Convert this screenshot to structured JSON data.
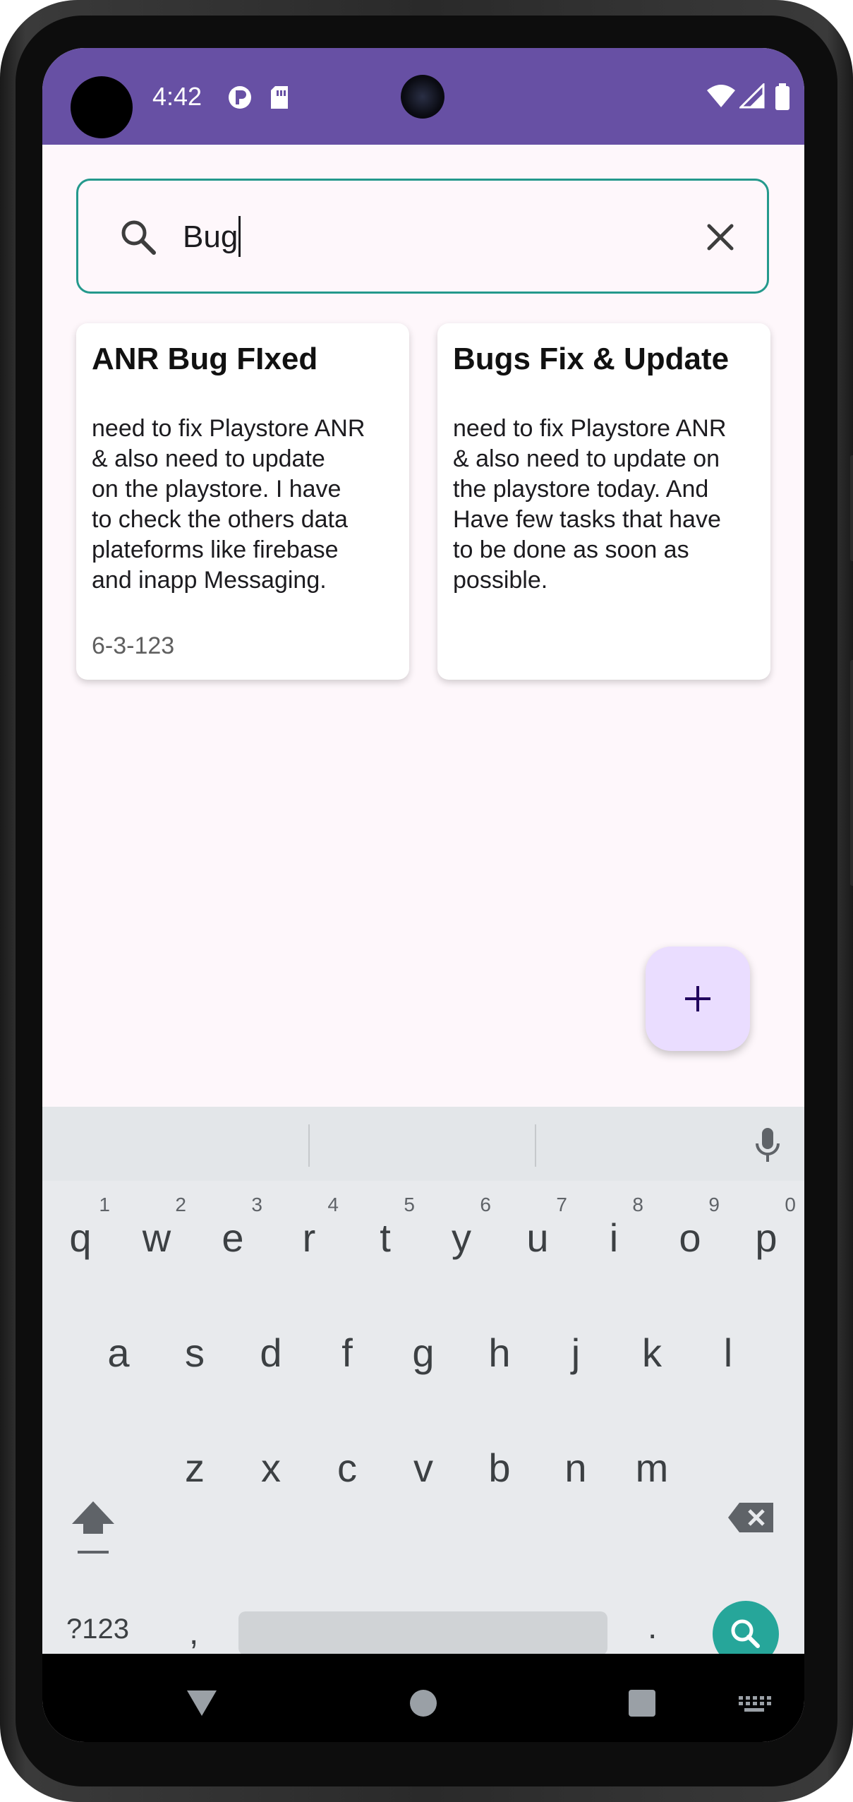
{
  "status_bar": {
    "time": "4:42",
    "background": "#6750a4",
    "icons": [
      "notification-p-icon",
      "sim-card-icon",
      "wifi-icon",
      "signal-icon",
      "battery-icon"
    ]
  },
  "search": {
    "value": "Bug",
    "border_color": "#24998c",
    "icon": "search-icon",
    "clear_icon": "close-icon"
  },
  "notes": [
    {
      "title": "ANR Bug FIxed",
      "lines": [
        "need to fix Playstore ANR",
        "& also need to update",
        "on the playstore. I have",
        "to check the others data",
        "plateforms like firebase",
        "and inapp Messaging."
      ],
      "date": "6-3-123"
    },
    {
      "title": "Bugs Fix & Update",
      "lines": [
        "need to fix Playstore ANR",
        "& also need to update on",
        "the playstore today. And",
        "Have few tasks that have",
        "to be done as soon as",
        "possible."
      ],
      "date": ""
    }
  ],
  "fab": {
    "label": "+",
    "background": "#eaddff"
  },
  "keyboard": {
    "row1": [
      {
        "key": "q",
        "hint": "1"
      },
      {
        "key": "w",
        "hint": "2"
      },
      {
        "key": "e",
        "hint": "3"
      },
      {
        "key": "r",
        "hint": "4"
      },
      {
        "key": "t",
        "hint": "5"
      },
      {
        "key": "y",
        "hint": "6"
      },
      {
        "key": "u",
        "hint": "7"
      },
      {
        "key": "i",
        "hint": "8"
      },
      {
        "key": "o",
        "hint": "9"
      },
      {
        "key": "p",
        "hint": "0"
      }
    ],
    "row2": [
      "a",
      "s",
      "d",
      "f",
      "g",
      "h",
      "j",
      "k",
      "l"
    ],
    "row3": [
      "z",
      "x",
      "c",
      "v",
      "b",
      "n",
      "m"
    ],
    "symbols_label": "?123",
    "comma_label": ",",
    "period_label": ".",
    "action_color": "#26a69a"
  }
}
